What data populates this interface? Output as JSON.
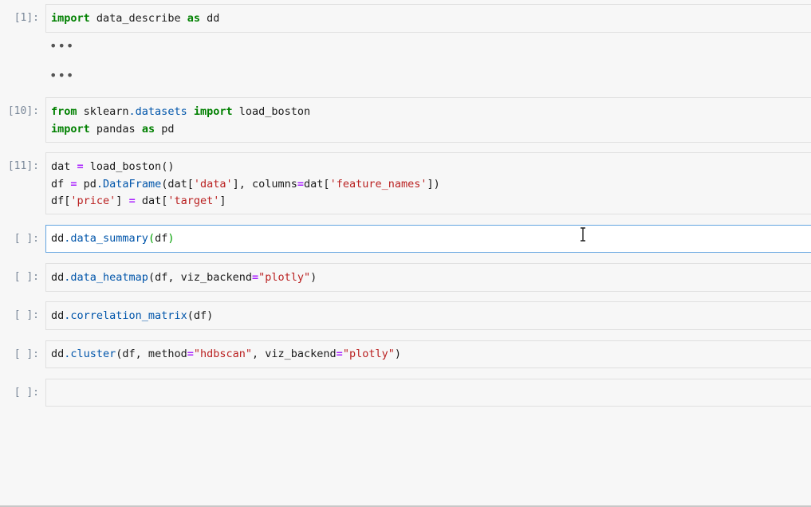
{
  "cells": [
    {
      "prompt": "[1]:",
      "lines": [
        "import data_describe as dd"
      ]
    },
    {
      "prompt": "[10]:",
      "lines": [
        "from sklearn.datasets import load_boston",
        "import pandas as pd"
      ]
    },
    {
      "prompt": "[11]:",
      "lines": [
        "dat = load_boston()",
        "df = pd.DataFrame(dat['data'], columns=dat['feature_names'])",
        "df['price'] = dat['target']"
      ]
    },
    {
      "prompt": "[ ]:",
      "lines": [
        "dd.data_summary(df)"
      ]
    },
    {
      "prompt": "[ ]:",
      "lines": [
        "dd.data_heatmap(df, viz_backend=\"plotly\")"
      ]
    },
    {
      "prompt": "[ ]:",
      "lines": [
        "dd.correlation_matrix(df)"
      ]
    },
    {
      "prompt": "[ ]:",
      "lines": [
        "dd.cluster(df, method=\"hdbscan\", viz_backend=\"plotly\")"
      ]
    },
    {
      "prompt": "[ ]:",
      "lines": [
        ""
      ]
    }
  ],
  "collapsed_outputs": [
    "•••",
    "•••"
  ],
  "cursor_icon": "text-cursor-icon"
}
